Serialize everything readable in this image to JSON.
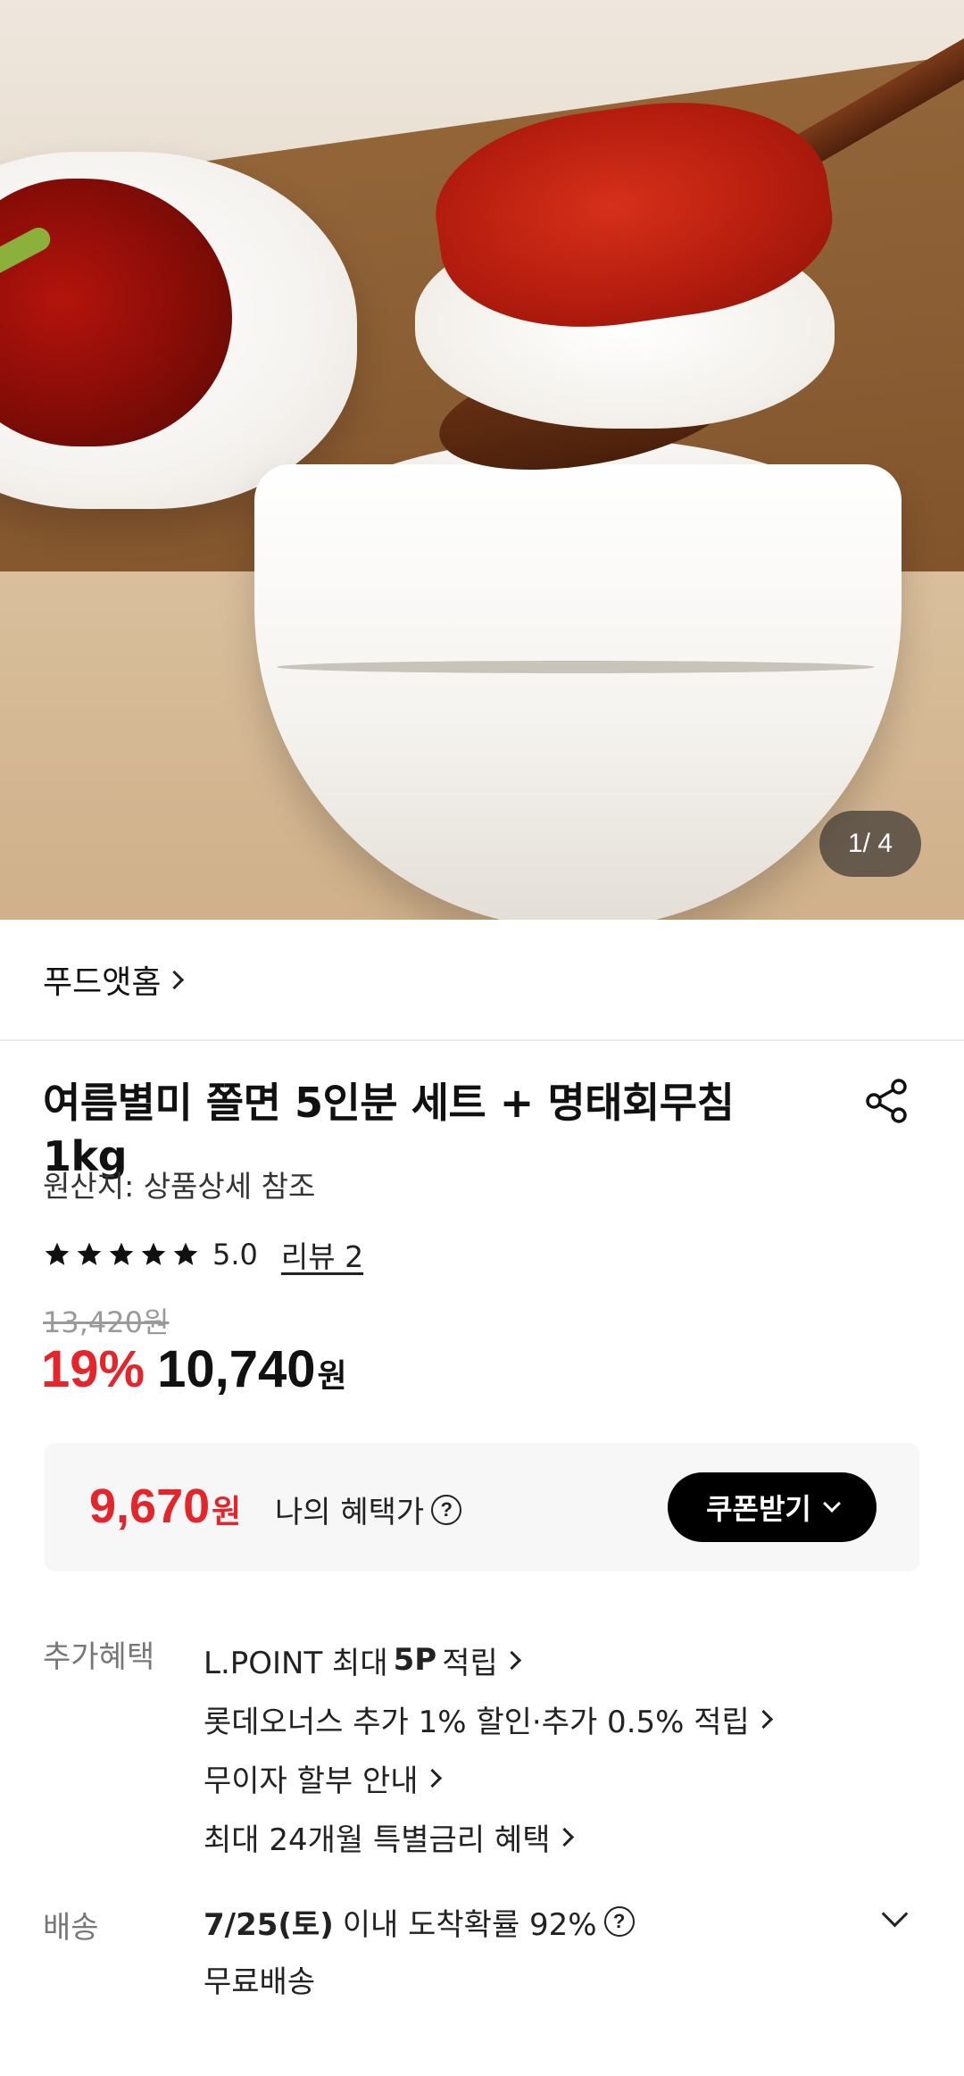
{
  "hero": {
    "image_counter": "1/ 4"
  },
  "brand": {
    "name": "푸드앳홈"
  },
  "product": {
    "title": "여름별미 쫄면 5인분 세트 + 명태회무침 1kg",
    "origin": "원산지: 상품상세 참조",
    "rating": "5.0",
    "stars": 5,
    "review_link": "리뷰 2",
    "original_price": "13,420원",
    "discount": "19%",
    "price": "10,740",
    "price_unit": "원"
  },
  "benefit": {
    "amount": "9,670",
    "unit": "원",
    "label": "나의 혜택가",
    "coupon_button": "쿠폰받기"
  },
  "extra_benefits": {
    "label": "추가혜택",
    "items": [
      {
        "prefix": "L.POINT 최대",
        "bold": "5P",
        "suffix": "적립"
      },
      {
        "prefix": "롯데오너스 추가 1% 할인·추가 0.5% 적립",
        "bold": "",
        "suffix": ""
      },
      {
        "prefix": "무이자 할부 안내",
        "bold": "",
        "suffix": ""
      },
      {
        "prefix": "최대 24개월 특별금리 혜택",
        "bold": "",
        "suffix": ""
      }
    ]
  },
  "delivery": {
    "label": "배송",
    "date": "7/25(토)",
    "info": "이내 도착확률 92%",
    "sub": "무료배송"
  },
  "colors": {
    "accent_red": "#e4252b",
    "button_black": "#000000",
    "benefit_bg": "#f7f7f7"
  },
  "icons": [
    "share-icon",
    "star-icon",
    "question-icon",
    "chevron-right-icon",
    "chevron-down-icon"
  ]
}
